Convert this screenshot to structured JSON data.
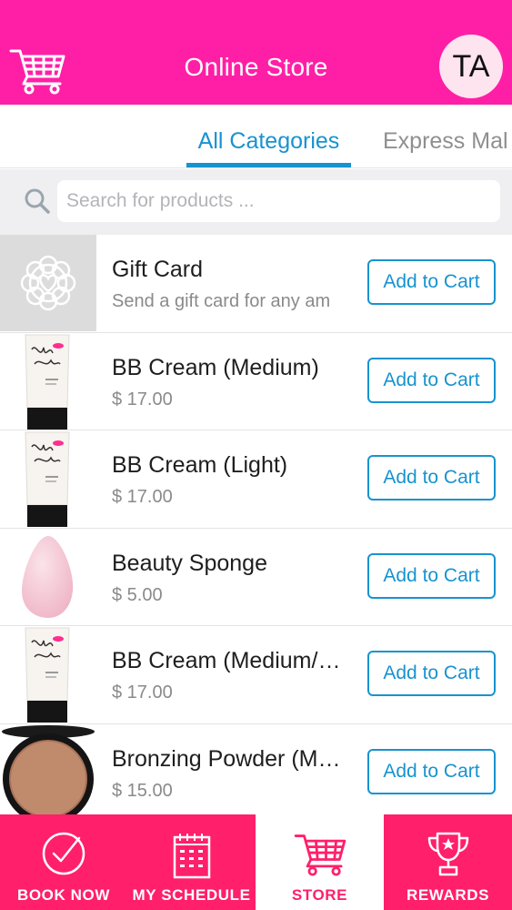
{
  "header": {
    "title": "Online Store",
    "avatar_initials": "TA",
    "cart_icon": "cart-icon"
  },
  "tabs": [
    {
      "label": "All Categories",
      "active": true
    },
    {
      "label": "Express Mal",
      "active": false
    }
  ],
  "search": {
    "placeholder": "Search for products ...",
    "value": "",
    "icon": "search-icon"
  },
  "products": [
    {
      "name": "Gift Card",
      "subtitle": "Send a gift card for any am",
      "button_label": "Add to Cart",
      "thumb": "gift-card-image"
    },
    {
      "name": "BB Cream (Medium)",
      "subtitle": "$ 17.00",
      "button_label": "Add to Cart",
      "thumb": "bb-cream-tube-image"
    },
    {
      "name": "BB Cream (Light)",
      "subtitle": "$ 17.00",
      "button_label": "Add to Cart",
      "thumb": "bb-cream-tube-image"
    },
    {
      "name": "Beauty Sponge",
      "subtitle": "$ 5.00",
      "button_label": "Add to Cart",
      "thumb": "beauty-sponge-image"
    },
    {
      "name": "BB Cream (Medium/…",
      "subtitle": "$ 17.00",
      "button_label": "Add to Cart",
      "thumb": "bb-cream-tube-image"
    },
    {
      "name": "Bronzing Powder (M…",
      "subtitle": "$ 15.00",
      "button_label": "Add to Cart",
      "thumb": "bronzing-powder-image"
    }
  ],
  "bottom_nav": [
    {
      "label": "BOOK NOW",
      "icon": "check-circle-icon",
      "active": false
    },
    {
      "label": "MY SCHEDULE",
      "icon": "calendar-icon",
      "active": false
    },
    {
      "label": "STORE",
      "icon": "cart-icon",
      "active": true
    },
    {
      "label": "REWARDS",
      "icon": "trophy-icon",
      "active": false
    }
  ],
  "colors": {
    "header_pink": "#ff1fa6",
    "nav_pink": "#ff1f6b",
    "accent_blue": "#1793cf"
  }
}
